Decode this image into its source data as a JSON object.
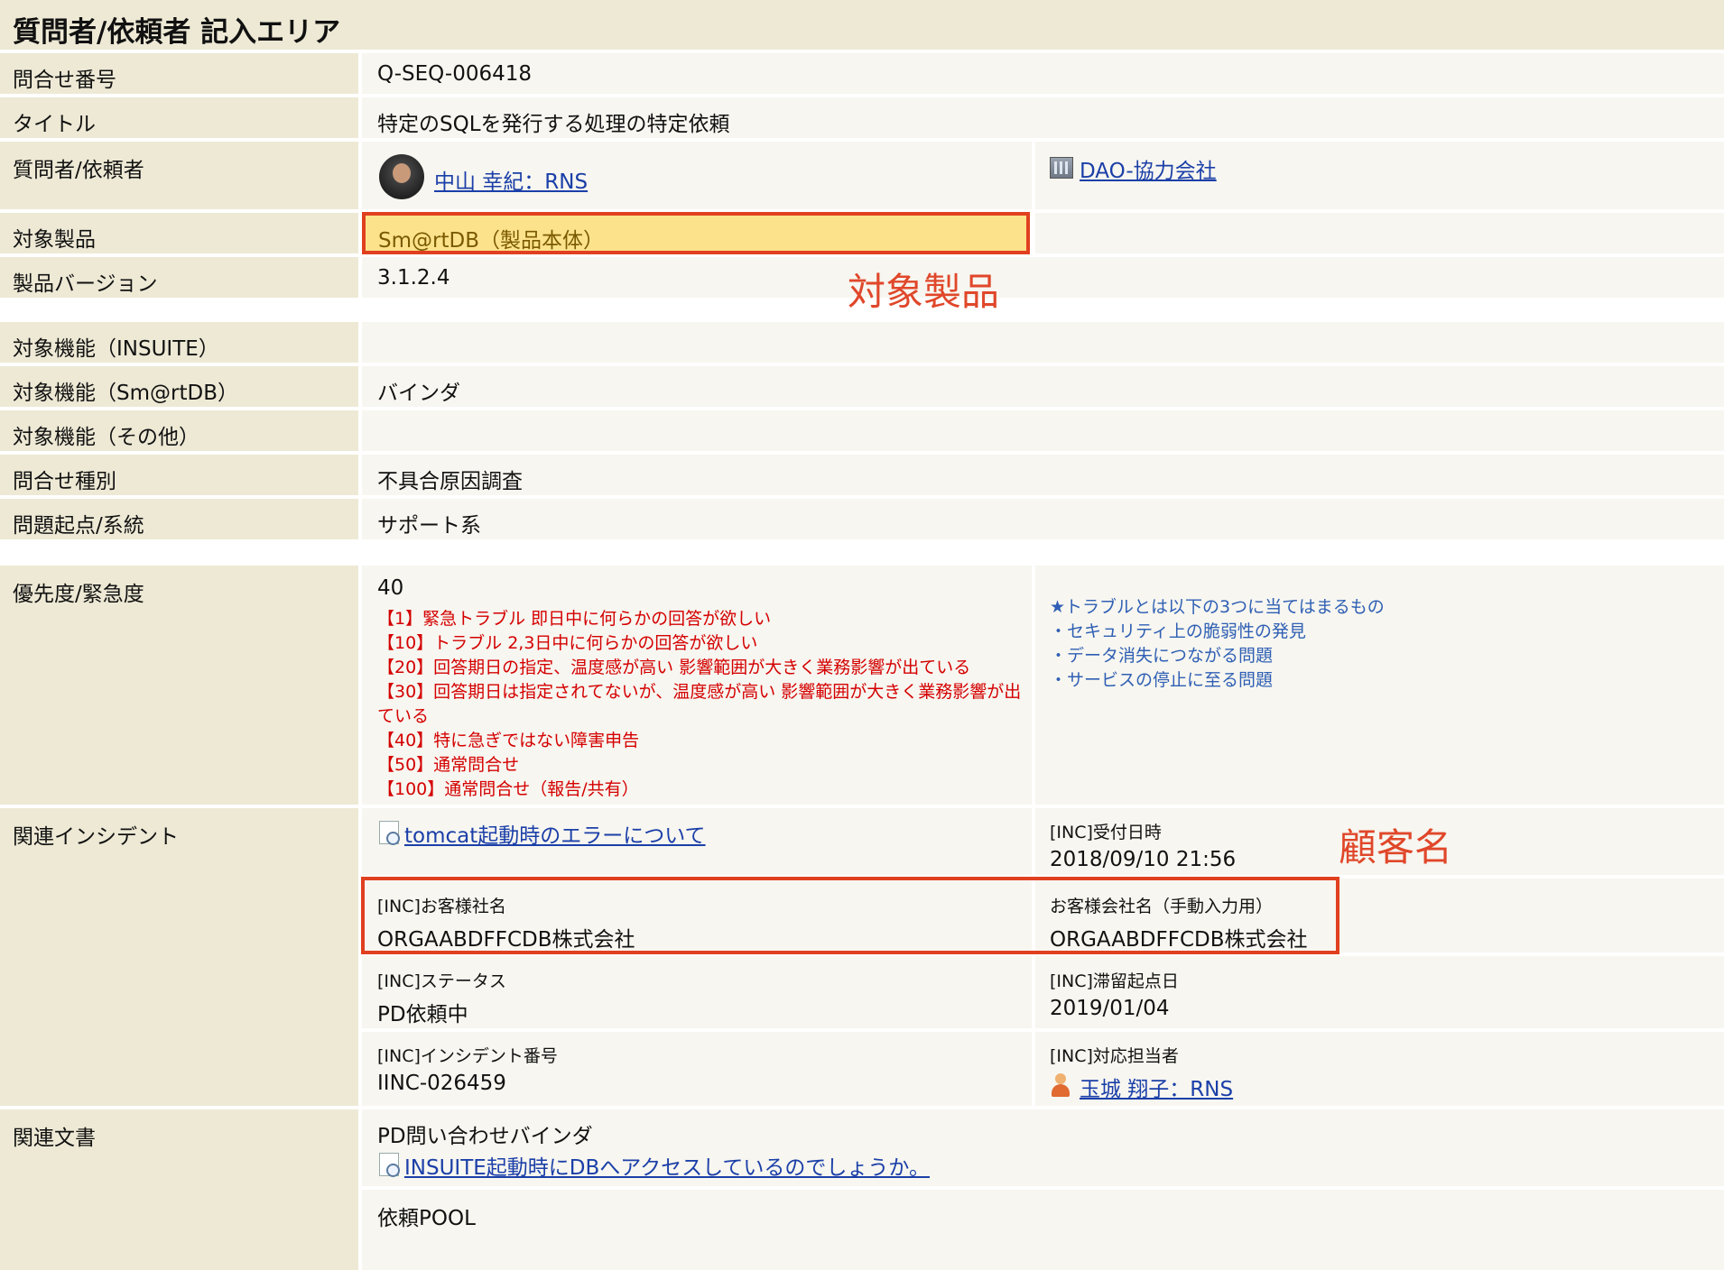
{
  "section_title": "質問者/依頼者 記入エリア",
  "rows": {
    "inquiry_number": {
      "label": "問合せ番号",
      "value": "Q-SEQ-006418"
    },
    "title": {
      "label": "タイトル",
      "value": "特定のSQLを発行する処理の特定依頼"
    },
    "requester": {
      "label": "質問者/依頼者",
      "person": "中山 幸紀：RNS",
      "company": "DAO-協力会社"
    },
    "product": {
      "label": "対象製品",
      "value": "Sm@rtDB（製品本体）"
    },
    "product_version": {
      "label": "製品バージョン",
      "value": "3.1.2.4"
    },
    "func_insuite": {
      "label": "対象機能（INSUITE）",
      "value": ""
    },
    "func_smartdb": {
      "label": "対象機能（Sm@rtDB）",
      "value": "バインダ"
    },
    "func_other": {
      "label": "対象機能（その他）",
      "value": ""
    },
    "inquiry_type": {
      "label": "問合せ種別",
      "value": "不具合原因調査"
    },
    "problem_origin": {
      "label": "問題起点/系統",
      "value": "サポート系"
    },
    "priority": {
      "label": "優先度/緊急度",
      "value": "40",
      "legend": [
        "【1】緊急トラブル 即日中に何らかの回答が欲しい",
        "【10】トラブル 2,3日中に何らかの回答が欲しい",
        "【20】回答期日の指定、温度感が高い 影響範囲が大きく業務影響が出ている",
        "【30】回答期日は指定されてないが、温度感が高い 影響範囲が大きく業務影響が出ている",
        "【40】特に急ぎではない障害申告",
        "【50】通常問合せ",
        "【100】通常問合せ（報告/共有）"
      ],
      "notes": [
        "★トラブルとは以下の3つに当てはまるもの",
        "・セキュリティ上の脆弱性の発見",
        "・データ消失につながる問題",
        "・サービスの停止に至る問題"
      ]
    },
    "related_incident": {
      "label": "関連インシデント",
      "incident_link": "tomcat起動時のエラーについて",
      "received_label": "[INC]受付日時",
      "received_value": "2018/09/10 21:56",
      "customer_label": "[INC]お客様社名",
      "customer_value": "ORGAABDFFCDB株式会社",
      "customer_manual_label": "お客様会社名（手動入力用）",
      "customer_manual_value": "ORGAABDFFCDB株式会社",
      "status_label": "[INC]ステータス",
      "status_value": "PD依頼中",
      "stagnation_label": "[INC]滞留起点日",
      "stagnation_value": "2019/01/04",
      "incident_no_label": "[INC]インシデント番号",
      "incident_no_value": "IINC-026459",
      "assignee_label": "[INC]対応担当者",
      "assignee_value": "玉城 翔子：RNS"
    },
    "related_docs": {
      "label": "関連文書",
      "doc1_title": "PD問い合わせバインダ",
      "doc1_link": "INSUITE起動時にDBへアクセスしているのでしょうか。",
      "doc2_title": "依頼POOL"
    }
  },
  "annotations": {
    "product": "対象製品",
    "customer": "顧客名"
  }
}
